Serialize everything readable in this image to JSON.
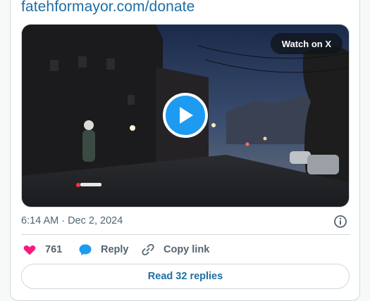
{
  "post": {
    "link_text": "fatehformayor.com/donate",
    "timestamp": "6:14 AM · Dec 2, 2024"
  },
  "media": {
    "watch_label": "Watch on X",
    "play_icon": "play-icon"
  },
  "actions": {
    "likes": "761",
    "reply_label": "Reply",
    "copy_label": "Copy link"
  },
  "read_replies_label": "Read 32 replies",
  "colors": {
    "like": "#f91880",
    "reply": "#1d9bf0",
    "link": "#1d6fa5",
    "muted": "#536471",
    "border": "#cfd9de"
  }
}
